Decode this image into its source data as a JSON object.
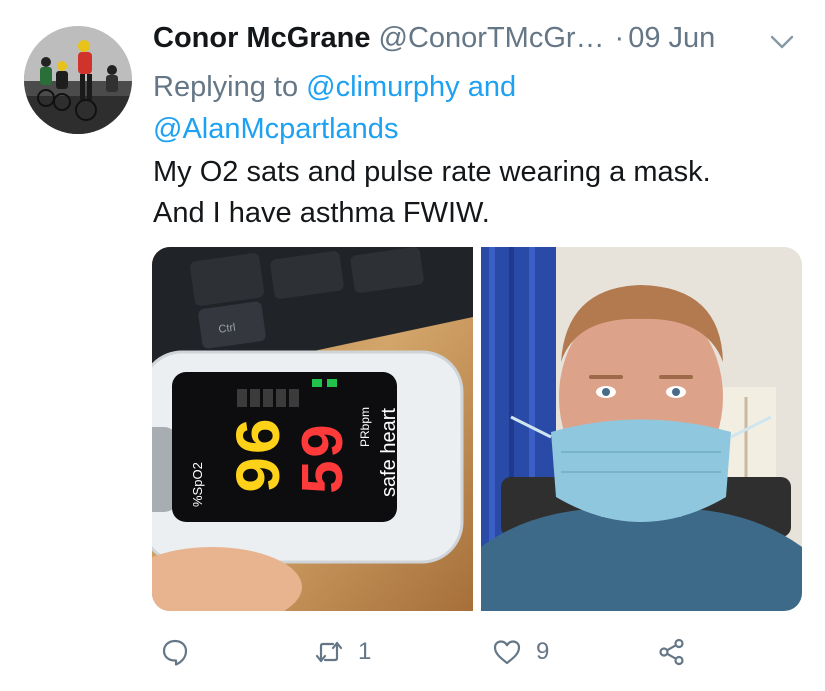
{
  "tweet": {
    "author_name": "Conor McGrane",
    "author_handle": "@ConorTMcGr…",
    "separator": "·",
    "date": "09 Jun",
    "replying_prefix": "Replying to ",
    "mention_1": "@climurphy",
    "replying_join": " and",
    "mention_2": "@AlanMcpartlands",
    "text_line_1": "My O2 sats and pulse rate wearing a mask.",
    "text_line_2": "And I have asthma FWIW."
  },
  "actions": {
    "reply_count": "",
    "retweet_count": "1",
    "like_count": "9",
    "share_count": ""
  },
  "icons": {
    "menu": "chevron-down-icon",
    "reply": "reply-icon",
    "retweet": "retweet-icon",
    "like": "heart-icon",
    "share": "share-icon"
  },
  "photos": {
    "oximeter": {
      "brand": "safe heart",
      "spo2_label": "%SpO2",
      "pr_label": "PRbpm",
      "spo2_value": "96",
      "pulse_value": "59",
      "key_label": "Ctrl"
    }
  },
  "colors": {
    "link": "#1da1f2",
    "secondary_text": "#657786",
    "primary_text": "#14171a"
  }
}
